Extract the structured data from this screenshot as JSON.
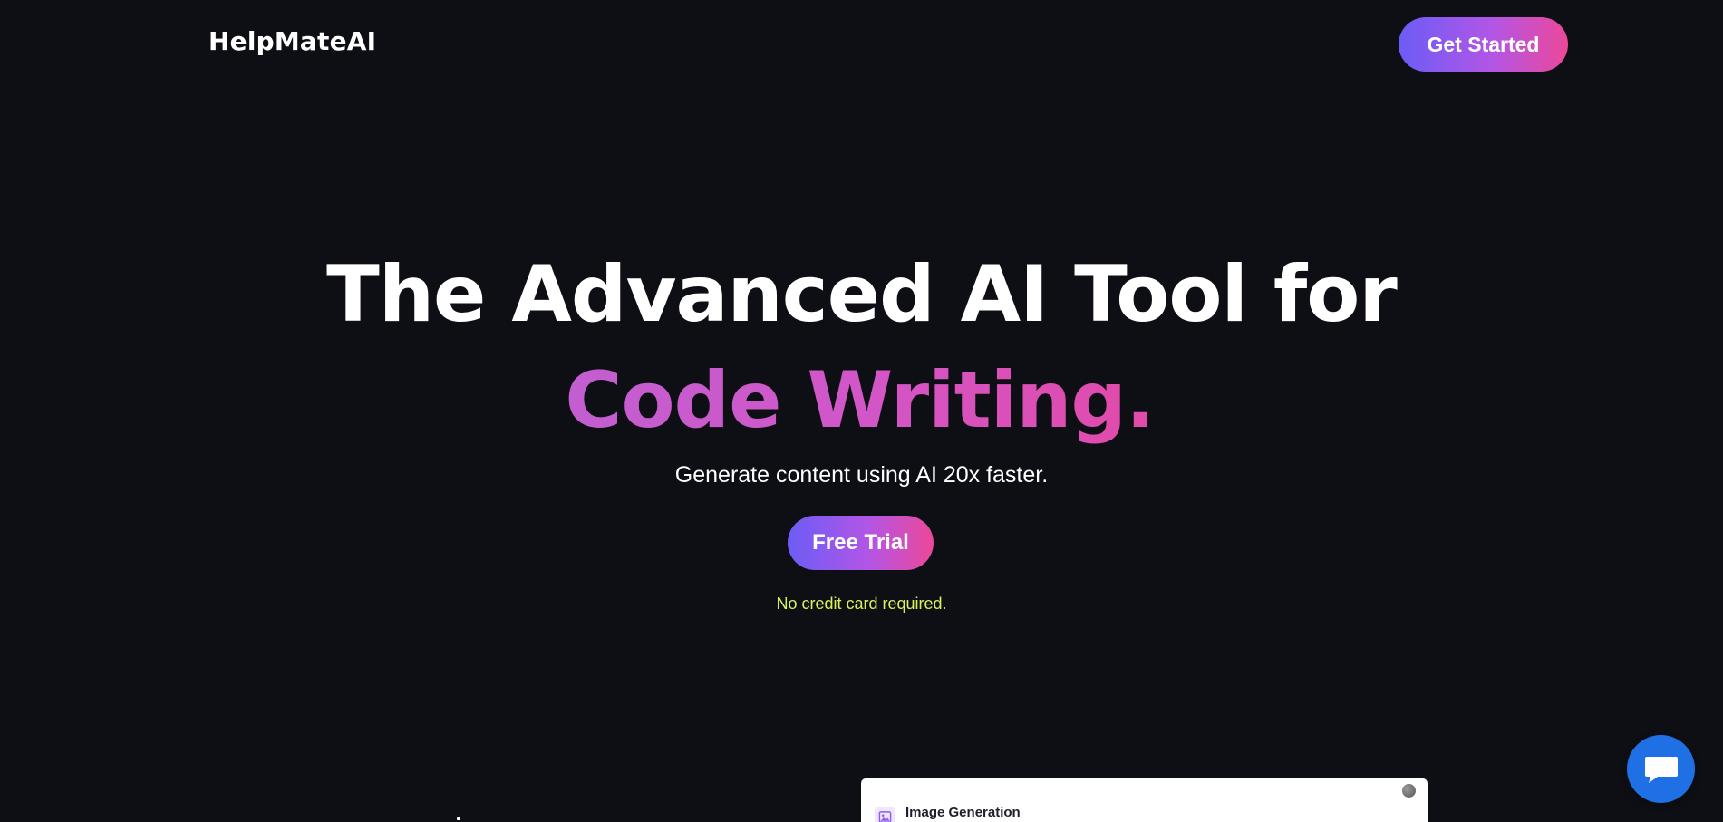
{
  "header": {
    "logo": "HelpMateAI",
    "cta_label": "Get Started"
  },
  "hero": {
    "title_line1": "The Advanced AI Tool for",
    "title_line2": "Code Writing.",
    "subtitle": "Generate content using AI 20x faster.",
    "cta_label": "Free Trial",
    "note": "No credit card required."
  },
  "preview": {
    "title": "Image Generation",
    "icon": "image-icon"
  },
  "chat": {
    "icon": "chat-icon"
  },
  "colors": {
    "background": "#0e0f14",
    "gradient_start": "#6b5cf6",
    "gradient_end": "#ec4899",
    "note": "#d9f25c",
    "chat": "#1f6fe5"
  }
}
